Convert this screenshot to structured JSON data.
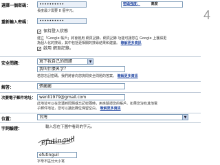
{
  "page_number": "4",
  "form": {
    "password": {
      "label": "選擇一個密碼：",
      "value": "••••••••••",
      "hint": "長度最少需要 8 個字元。",
      "strength_label": "密碼強度：",
      "strength_value": "高度"
    },
    "confirm": {
      "label": "重新輸入密碼：",
      "value": "••••••••••"
    },
    "stay_signed_in": {
      "checkbox_checked": true,
      "label": "保持登入狀態"
    },
    "web_history": {
      "checkbox_checked": true,
      "description_line1": "建立「Google 帳戶」將會啟用 網頁記錄。網頁記錄 功能可讓您在 Google 上獲得更",
      "description_line2": "為個人化的搜尋，其中包括更相關的搜尋結果和建議。",
      "learn_more": "瞭解更多資訊",
      "label": "啟用 網頁記錄。"
    },
    "security_question": {
      "label": "安全問題：",
      "select_value": "寫下我自己的問題",
      "custom_question": "我叫什麼名字？",
      "hint": "若您忘記密碼，我們將會向您詢問安全問題的答案。",
      "learn_more": "瞭解更多資訊"
    },
    "answer": {
      "label": "解答：",
      "value": "張麗麗"
    },
    "recovery_email": {
      "label": "次要電子郵件地址：",
      "value": "wenli1979@gmail.com",
      "hint_line1": "此地址可以在您遇到問題或忘記密碼時，用來驗證您的帳戶。如果您沒有其他電",
      "hint_line2": "子郵件地址，您可以讓此欄位保留空白。",
      "learn_more": "瞭解更多資訊"
    },
    "location": {
      "label": "位置：",
      "select_value": "台灣"
    },
    "word_verification": {
      "label": "字詞驗證：",
      "instruction": "輸入您在下圖中看到的字元。",
      "captcha_text": "efutinguil",
      "input_value": "efutinguil",
      "hint": "字母不區分大小寫"
    }
  },
  "colors": {
    "shaded_row": "#eaf0f8",
    "link": "#2a4ea6",
    "border": "#7f9db9"
  }
}
